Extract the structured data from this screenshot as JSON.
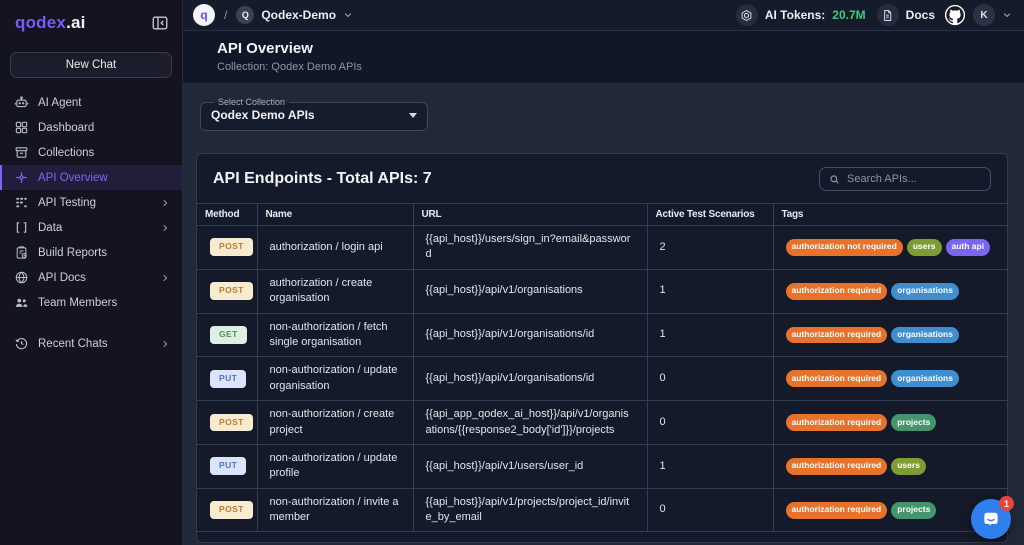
{
  "brand": {
    "logo_primary": "qodex",
    "logo_suffix": ".ai"
  },
  "topbar": {
    "breadcrumb": {
      "org_initial": "q",
      "separator": "/",
      "project_initial": "Q",
      "project_name": "Qodex-Demo"
    },
    "ai_tokens_label": "AI Tokens:",
    "ai_tokens_value": "20.7M",
    "docs_label": "Docs",
    "avatar_initial": "K"
  },
  "sidebar": {
    "new_chat_label": "New Chat",
    "items": [
      {
        "label": "AI Agent",
        "icon": "robot-icon",
        "active": false,
        "chevron": false
      },
      {
        "label": "Dashboard",
        "icon": "dashboard-grid-icon",
        "active": false,
        "chevron": false
      },
      {
        "label": "Collections",
        "icon": "collections-box-icon",
        "active": false,
        "chevron": false
      },
      {
        "label": "API Overview",
        "icon": "api-node-icon",
        "active": true,
        "chevron": false
      },
      {
        "label": "API Testing",
        "icon": "testing-grid-icon",
        "active": false,
        "chevron": true
      },
      {
        "label": "Data",
        "icon": "brackets-icon",
        "active": false,
        "chevron": true
      },
      {
        "label": "Build Reports",
        "icon": "report-clipboard-icon",
        "active": false,
        "chevron": false
      },
      {
        "label": "API Docs",
        "icon": "globe-icon",
        "active": false,
        "chevron": true
      },
      {
        "label": "Team Members",
        "icon": "team-icon",
        "active": false,
        "chevron": false
      }
    ],
    "recent_chats": {
      "label": "Recent Chats",
      "icon": "history-icon",
      "chevron": true
    }
  },
  "header": {
    "title": "API Overview",
    "subtitle": "Collection: Qodex Demo APIs"
  },
  "collection_select": {
    "label": "Select Collection",
    "value": "Qodex Demo APIs"
  },
  "endpoints_panel": {
    "title": "API Endpoints - Total APIs: 7",
    "search_placeholder": "Search APIs...",
    "table": {
      "columns": [
        "Method",
        "Name",
        "URL",
        "Active Test Scenarios",
        "Tags"
      ],
      "rows": [
        {
          "method": "POST",
          "name": "authorization / login api",
          "url": "{{api_host}}/users/sign_in?email&password",
          "scenarios": "2",
          "tags": [
            {
              "label": "authorization not required",
              "color": "orange"
            },
            {
              "label": "users",
              "color": "olive"
            },
            {
              "label": "auth api",
              "color": "purple"
            }
          ]
        },
        {
          "method": "POST",
          "name": "authorization / create organisation",
          "url": "{{api_host}}/api/v1/organisations",
          "scenarios": "1",
          "tags": [
            {
              "label": "authorization required",
              "color": "orange"
            },
            {
              "label": "organisations",
              "color": "blue"
            }
          ]
        },
        {
          "method": "GET",
          "name": "non-authorization / fetch single organisation",
          "url": "{{api_host}}/api/v1/organisations/id",
          "scenarios": "1",
          "tags": [
            {
              "label": "authorization required",
              "color": "orange"
            },
            {
              "label": "organisations",
              "color": "blue"
            }
          ]
        },
        {
          "method": "PUT",
          "name": "non-authorization / update organisation",
          "url": "{{api_host}}/api/v1/organisations/id",
          "scenarios": "0",
          "tags": [
            {
              "label": "authorization required",
              "color": "orange"
            },
            {
              "label": "organisations",
              "color": "blue"
            }
          ]
        },
        {
          "method": "POST",
          "name": "non-authorization / create project",
          "url": "{{api_app_qodex_ai_host}}/api/v1/organisations/{{response2_body['id']}}/projects",
          "scenarios": "0",
          "tags": [
            {
              "label": "authorization required",
              "color": "orange"
            },
            {
              "label": "projects",
              "color": "teal"
            }
          ]
        },
        {
          "method": "PUT",
          "name": "non-authorization / update profile",
          "url": "{{api_host}}/api/v1/users/user_id",
          "scenarios": "1",
          "tags": [
            {
              "label": "authorization required",
              "color": "orange"
            },
            {
              "label": "users",
              "color": "olive"
            }
          ]
        },
        {
          "method": "POST",
          "name": "non-authorization / invite a member",
          "url": "{{api_host}}/api/v1/projects/project_id/invite_by_email",
          "scenarios": "0",
          "tags": [
            {
              "label": "authorization required",
              "color": "orange"
            },
            {
              "label": "projects",
              "color": "teal"
            }
          ]
        }
      ]
    }
  },
  "chat_widget": {
    "badge": "1"
  },
  "colors": {
    "accent_purple": "#7d68f5",
    "tokens_green": "#41c97d",
    "chat_blue": "#2f80ec",
    "methods": {
      "POST": {
        "bg": "#f8ecd0",
        "fg": "#c3782f"
      },
      "GET": {
        "bg": "#def0e1",
        "fg": "#47985a"
      },
      "PUT": {
        "bg": "#dce4f9",
        "fg": "#4d72d8"
      }
    },
    "tags": {
      "orange": "#e7722b",
      "olive": "#7d9c34",
      "purple": "#7b66f2",
      "blue": "#3e8ed0",
      "teal": "#43966b"
    }
  }
}
